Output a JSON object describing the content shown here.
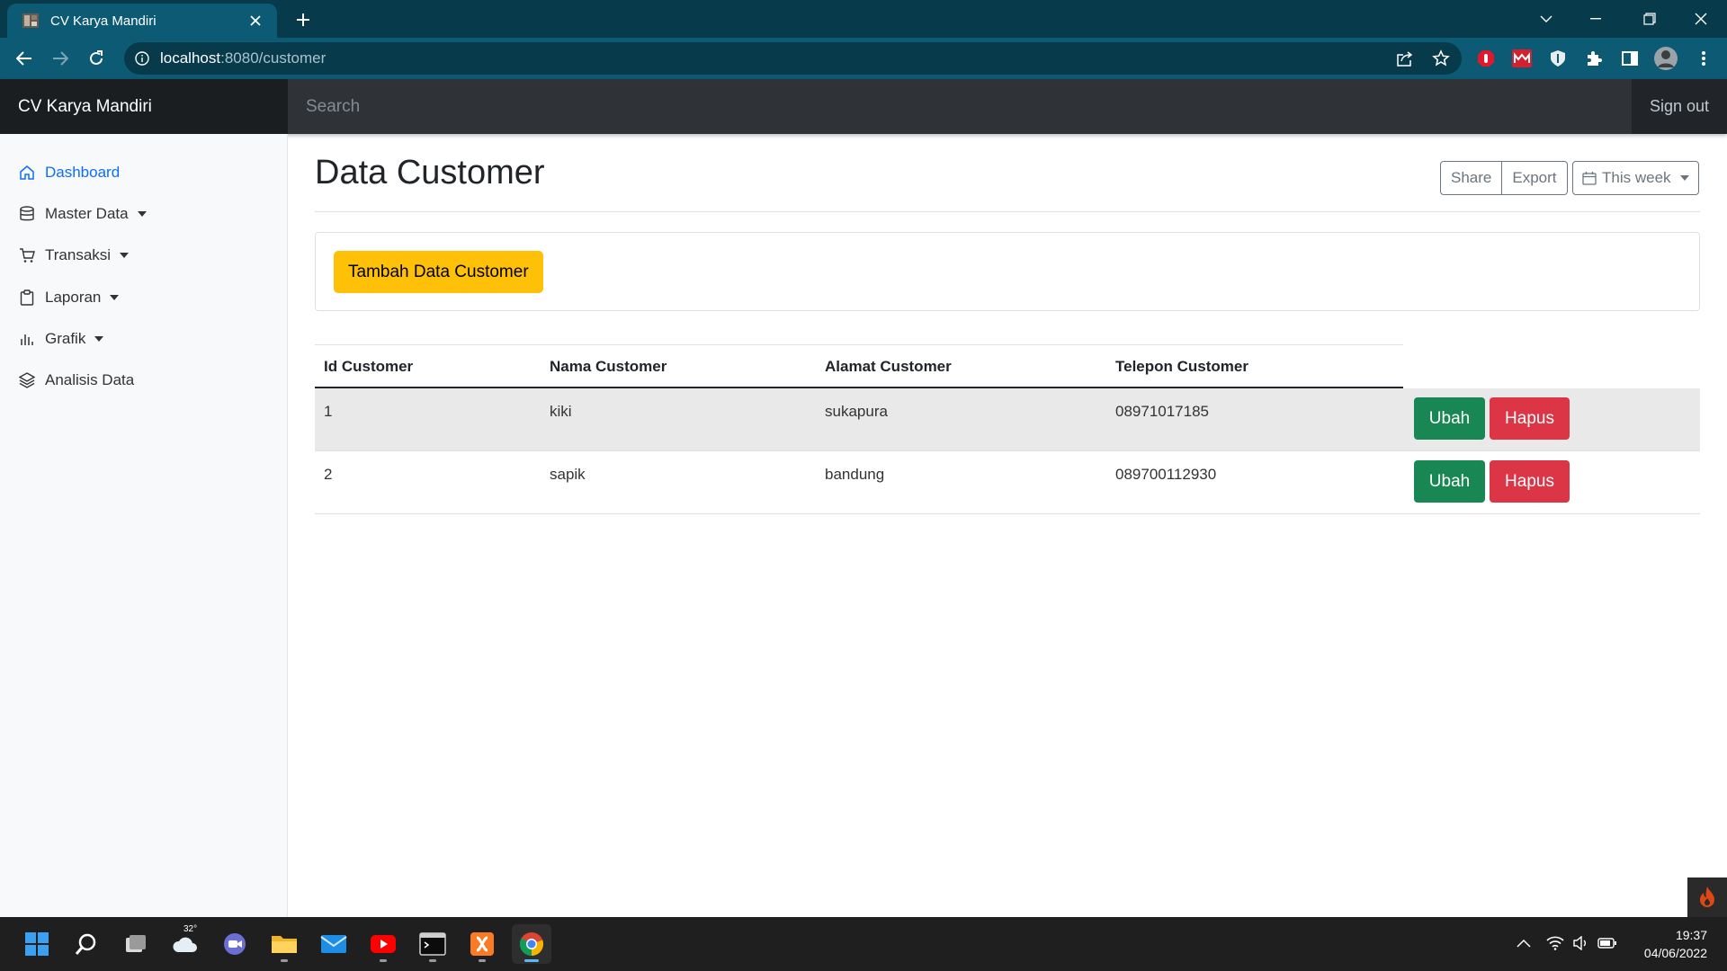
{
  "browser": {
    "tab_title": "CV Karya Mandiri",
    "url_host": "localhost",
    "url_path": ":8080/customer"
  },
  "navbar": {
    "brand": "CV Karya Mandiri",
    "search_placeholder": "Search",
    "signout_label": "Sign out"
  },
  "sidebar": {
    "items": [
      {
        "label": "Dashboard",
        "icon": "home-icon",
        "active": true
      },
      {
        "label": "Master Data",
        "icon": "database-icon",
        "dropdown": true
      },
      {
        "label": "Transaksi",
        "icon": "cart-icon",
        "dropdown": true
      },
      {
        "label": "Laporan",
        "icon": "clipboard-icon",
        "dropdown": true
      },
      {
        "label": "Grafik",
        "icon": "bar-chart-icon",
        "dropdown": true
      },
      {
        "label": "Analisis Data",
        "icon": "layers-icon"
      }
    ]
  },
  "main": {
    "title": "Data Customer",
    "share_label": "Share",
    "export_label": "Export",
    "period_label": "This week",
    "add_button_label": "Tambah Data Customer",
    "table": {
      "headers": [
        "Id Customer",
        "Nama Customer",
        "Alamat Customer",
        "Telepon Customer"
      ],
      "rows": [
        {
          "id": "1",
          "nama": "kiki",
          "alamat": "sukapura",
          "telepon": "08971017185"
        },
        {
          "id": "2",
          "nama": "sapik",
          "alamat": "bandung",
          "telepon": "089700112930"
        }
      ],
      "edit_label": "Ubah",
      "delete_label": "Hapus"
    }
  },
  "taskbar": {
    "weather_temp": "32°",
    "time": "19:37",
    "date": "04/06/2022"
  },
  "colors": {
    "primary": "#0d6efd",
    "warning": "#ffc107",
    "success": "#198754",
    "danger": "#dc3545",
    "navbar": "#212529",
    "browser_chrome": "#0d5a74"
  }
}
